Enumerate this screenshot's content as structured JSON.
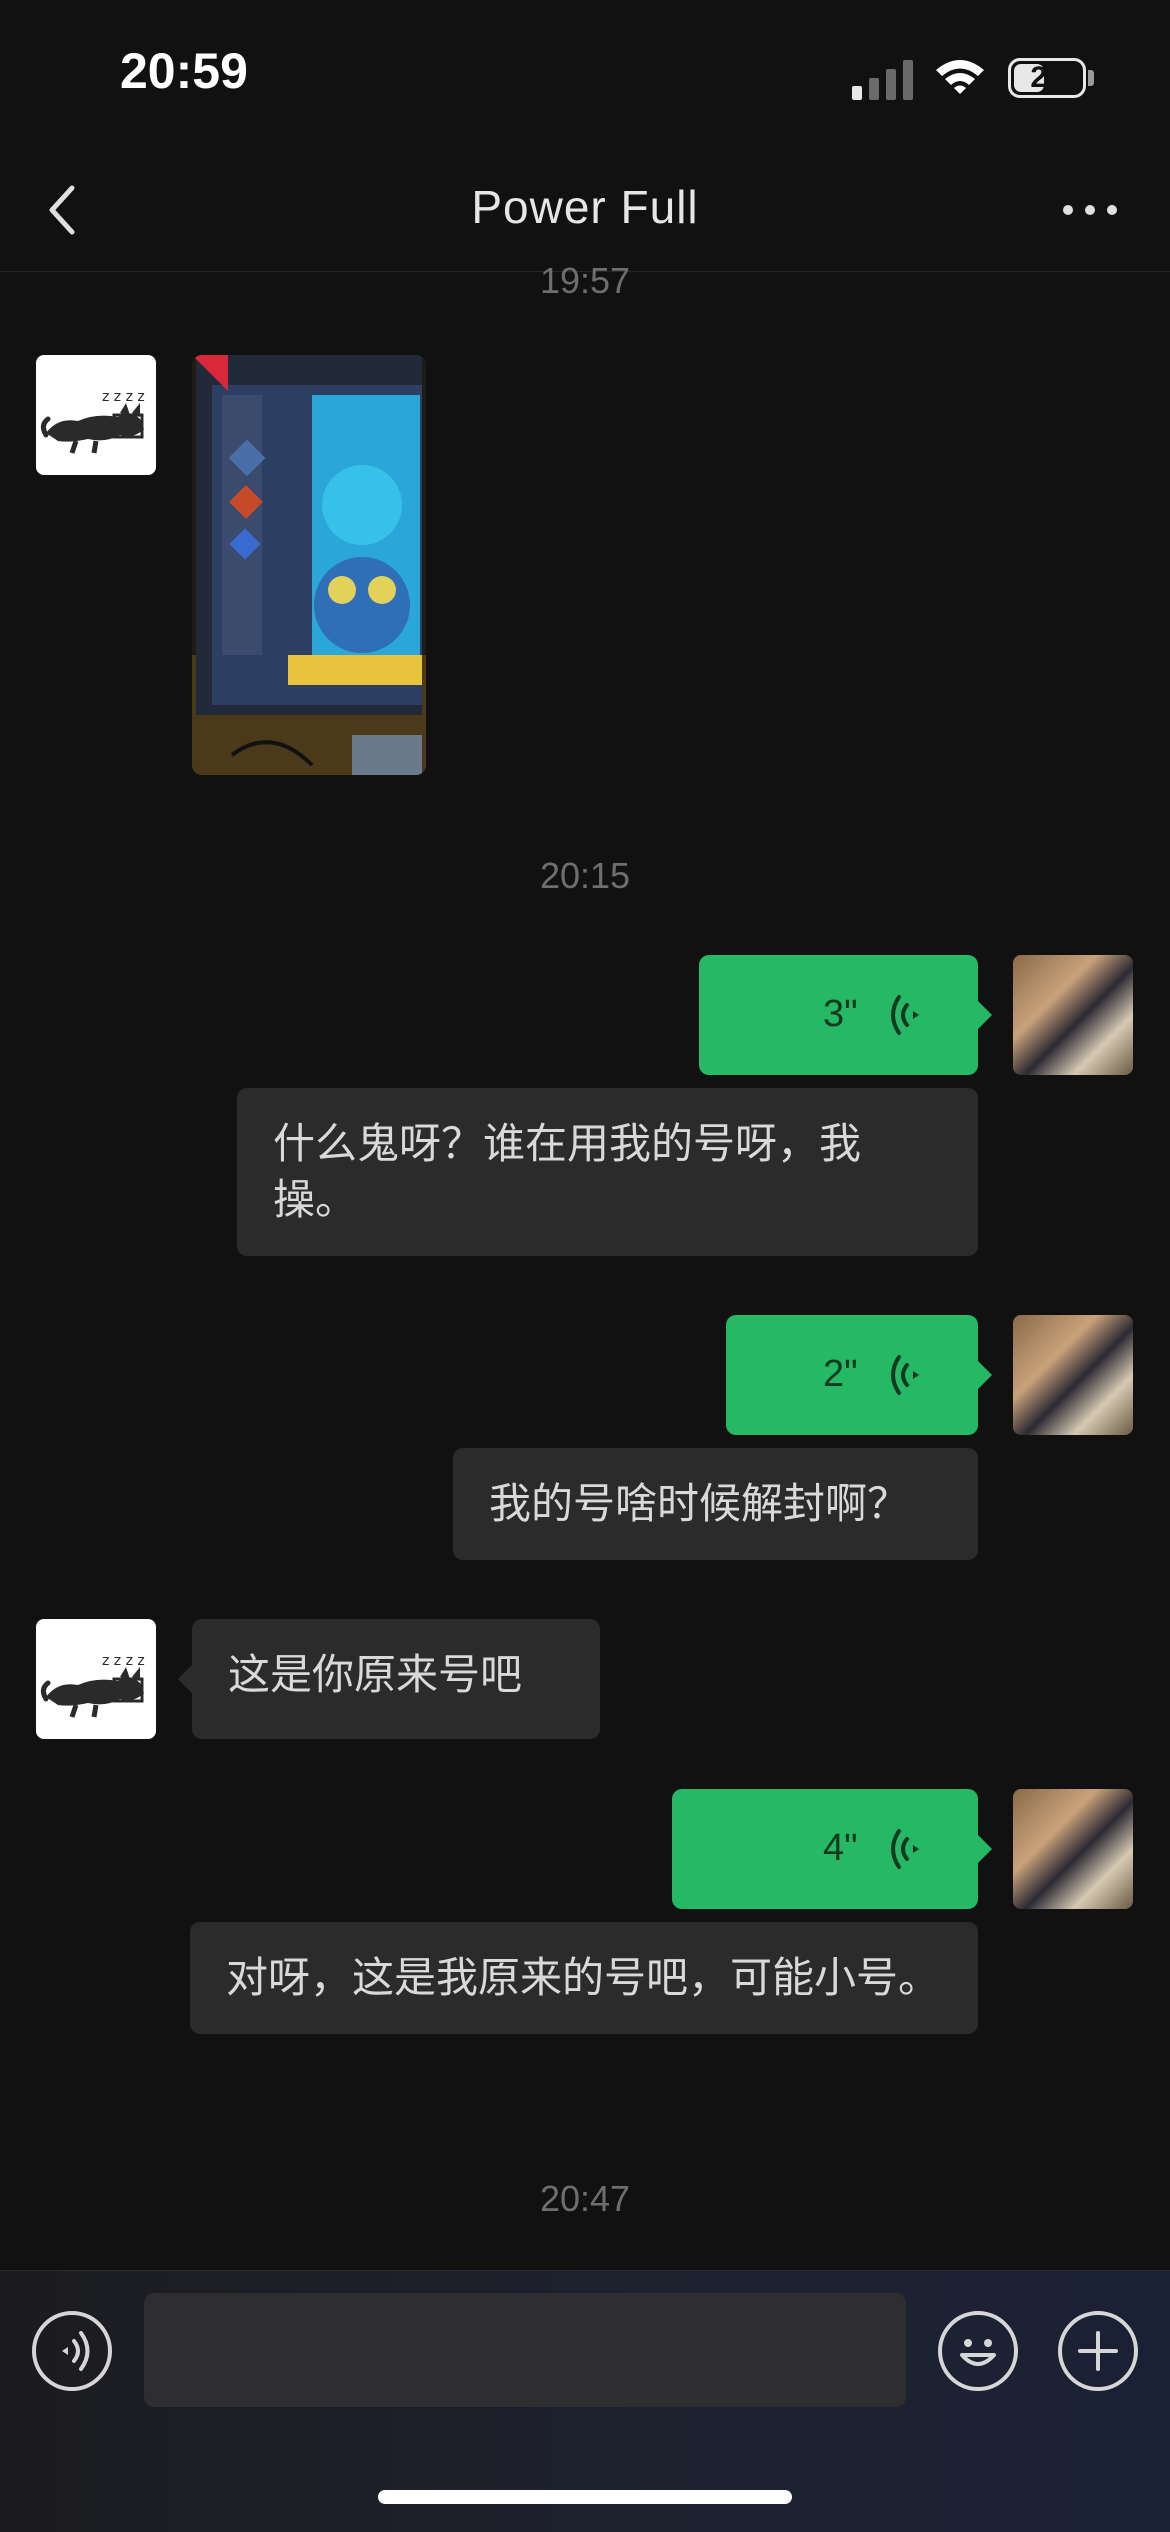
{
  "status_bar": {
    "time": "20:59",
    "battery_level": "25"
  },
  "nav": {
    "title": "Power  Full"
  },
  "timestamps": {
    "t1": "19:57",
    "t2": "20:15",
    "t3": "20:47"
  },
  "messages": {
    "voice1": {
      "duration": "3\""
    },
    "text1": "什么鬼呀？谁在用我的号呀，我操。",
    "voice2": {
      "duration": "2\""
    },
    "text2": "我的号啥时候解封啊？",
    "text3": "这是你原来号吧",
    "voice3": {
      "duration": "4\""
    },
    "text4": "对呀，这是我原来的号吧，可能小号。"
  },
  "colors": {
    "voice_bubble": "#25b865",
    "text_bubble": "#2b2b2b",
    "background": "#111111"
  },
  "icons": [
    "back-icon",
    "more-icon",
    "voice-mode-icon",
    "emoji-icon",
    "add-icon",
    "voice-wave-icon"
  ]
}
